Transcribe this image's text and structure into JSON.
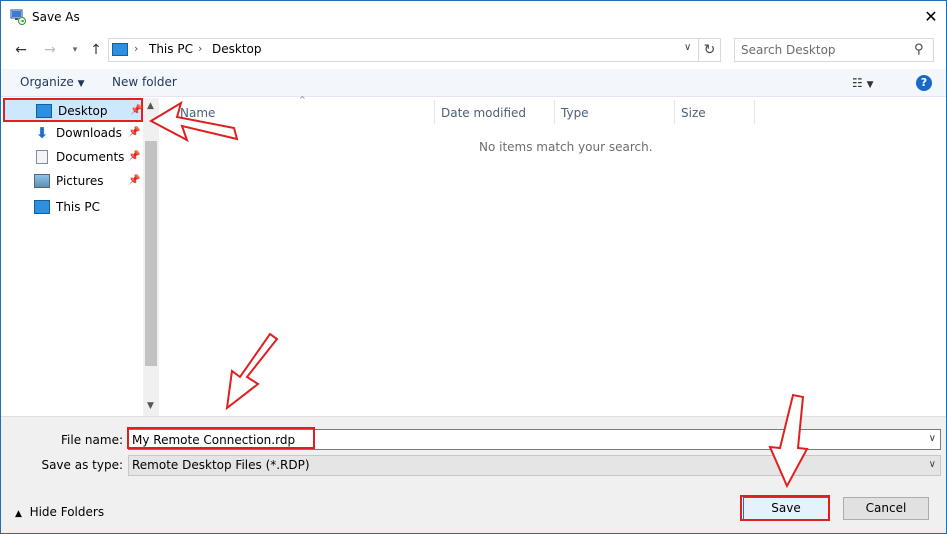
{
  "window": {
    "title": "Save As",
    "close_icon": "close-icon"
  },
  "address_bar": {
    "segments": [
      "This PC",
      "Desktop"
    ],
    "separator": "›"
  },
  "search": {
    "placeholder": "Search Desktop"
  },
  "toolbar": {
    "organize_label": "Organize",
    "new_folder_label": "New folder",
    "help_label": "?"
  },
  "nav_pane": {
    "items": [
      {
        "label": "Desktop",
        "icon": "desktop-icon",
        "pinned": true,
        "selected": true
      },
      {
        "label": "Downloads",
        "icon": "downloads-icon",
        "pinned": true
      },
      {
        "label": "Documents",
        "icon": "documents-icon",
        "pinned": true
      },
      {
        "label": "Pictures",
        "icon": "pictures-icon",
        "pinned": true
      },
      {
        "label": "This PC",
        "icon": "this-pc-icon",
        "pinned": false
      }
    ]
  },
  "file_list": {
    "columns": [
      "Name",
      "Date modified",
      "Type",
      "Size"
    ],
    "empty_message": "No items match your search."
  },
  "form": {
    "file_name_label": "File name:",
    "file_name_value": "My Remote Connection.rdp",
    "save_as_type_label": "Save as type:",
    "save_as_type_value": "Remote Desktop Files (*.RDP)"
  },
  "footer": {
    "hide_folders_label": "Hide Folders",
    "save_label": "Save",
    "cancel_label": "Cancel"
  },
  "colors": {
    "accent": "#0078d7",
    "annotation_red": "#e02020",
    "selected_nav": "#cce8ff"
  }
}
